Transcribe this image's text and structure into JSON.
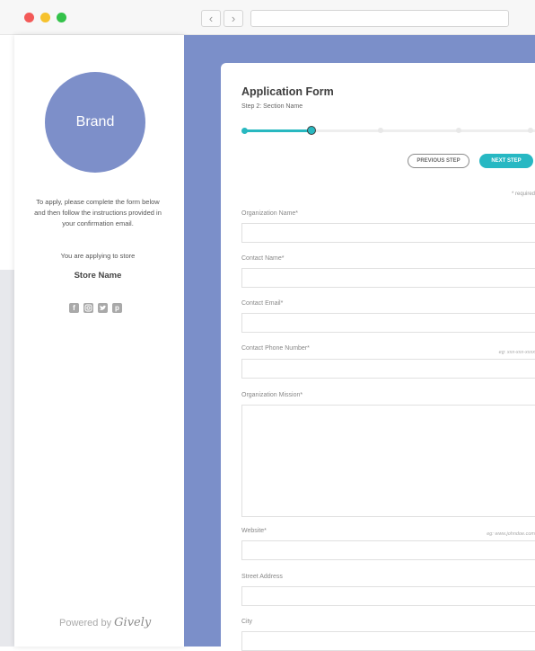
{
  "sidebar": {
    "brand": "Brand",
    "intro_text": "To apply, please complete the form below and then follow the instructions provided in your confirmation email.",
    "applying_text": "You are applying to store",
    "store_name": "Store Name",
    "social_icons": [
      "facebook-icon",
      "instagram-icon",
      "twitter-icon",
      "pinterest-icon"
    ],
    "powered_by": "Powered by",
    "powered_brand": "Gively"
  },
  "form": {
    "title": "Application Form",
    "step_label": "Step 2: Section Name",
    "progress": {
      "total_steps": 5,
      "current_step": 2
    },
    "prev_button": "PREVIOUS STEP",
    "next_button": "NEXT STEP",
    "required_note": "* required",
    "fields": {
      "org_name": {
        "label": "Organization Name*"
      },
      "contact_name": {
        "label": "Contact Name*"
      },
      "contact_email": {
        "label": "Contact Email*"
      },
      "contact_phone": {
        "label": "Contact Phone Number*",
        "hint": "eg: xxx-xxx-xxxx"
      },
      "org_mission": {
        "label": "Organization Mission*"
      },
      "website": {
        "label": "Website*",
        "hint": "eg: www.johndoe.com"
      },
      "street_address": {
        "label": "Street Address"
      },
      "city": {
        "label": "City"
      }
    }
  },
  "colors": {
    "accent": "#27b8c3",
    "brand_circle": "#7d8fc9",
    "main_background": "#7b8fc9"
  }
}
